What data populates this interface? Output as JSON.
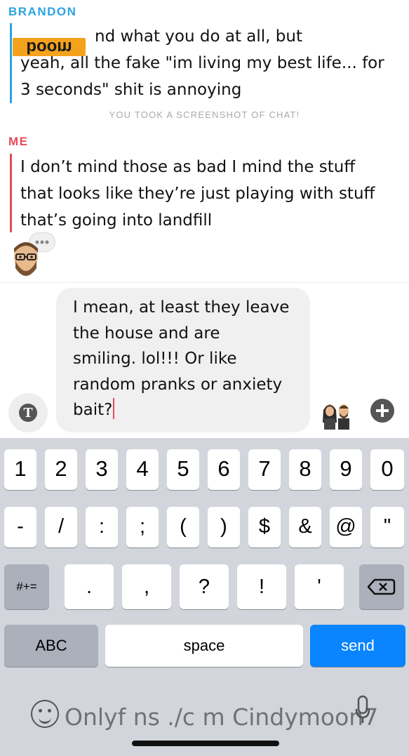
{
  "chat": {
    "brandon": {
      "sender": "BRANDON",
      "lines": [
        "nd what you do at all, but",
        "yeah, all the fake \"im living my best life... for",
        "3 seconds\" shit is annoying"
      ],
      "sticker_text": "boom"
    },
    "system_note": "YOU TOOK A SCREENSHOT OF CHAT!",
    "me": {
      "sender": "ME",
      "lines": [
        "I don’t mind those as bad I mind the stuff",
        "that looks like they’re just playing with stuff",
        "that’s going into landfill"
      ]
    },
    "accent_brandon": "#2aa3e0",
    "accent_me": "#e64b57"
  },
  "compose": {
    "lines": [
      "I mean, at least they leave",
      "the house and are",
      "smiling. lol!!! Or like",
      "random pranks or anxiety",
      "bait?"
    ],
    "text_tool_icon": "T"
  },
  "keyboard": {
    "row1": [
      "1",
      "2",
      "3",
      "4",
      "5",
      "6",
      "7",
      "8",
      "9",
      "0"
    ],
    "row2": [
      "-",
      "/",
      ":",
      ";",
      "(",
      ")",
      "$",
      "&",
      "@",
      "\""
    ],
    "row3_left": "#+=",
    "row3": [
      ".",
      ",",
      "?",
      "!",
      "'"
    ],
    "abc": "ABC",
    "space": "space",
    "send": "send",
    "send_color": "#0a84ff"
  },
  "watermark": "Onlyf ns ./c m Cindymoon7"
}
